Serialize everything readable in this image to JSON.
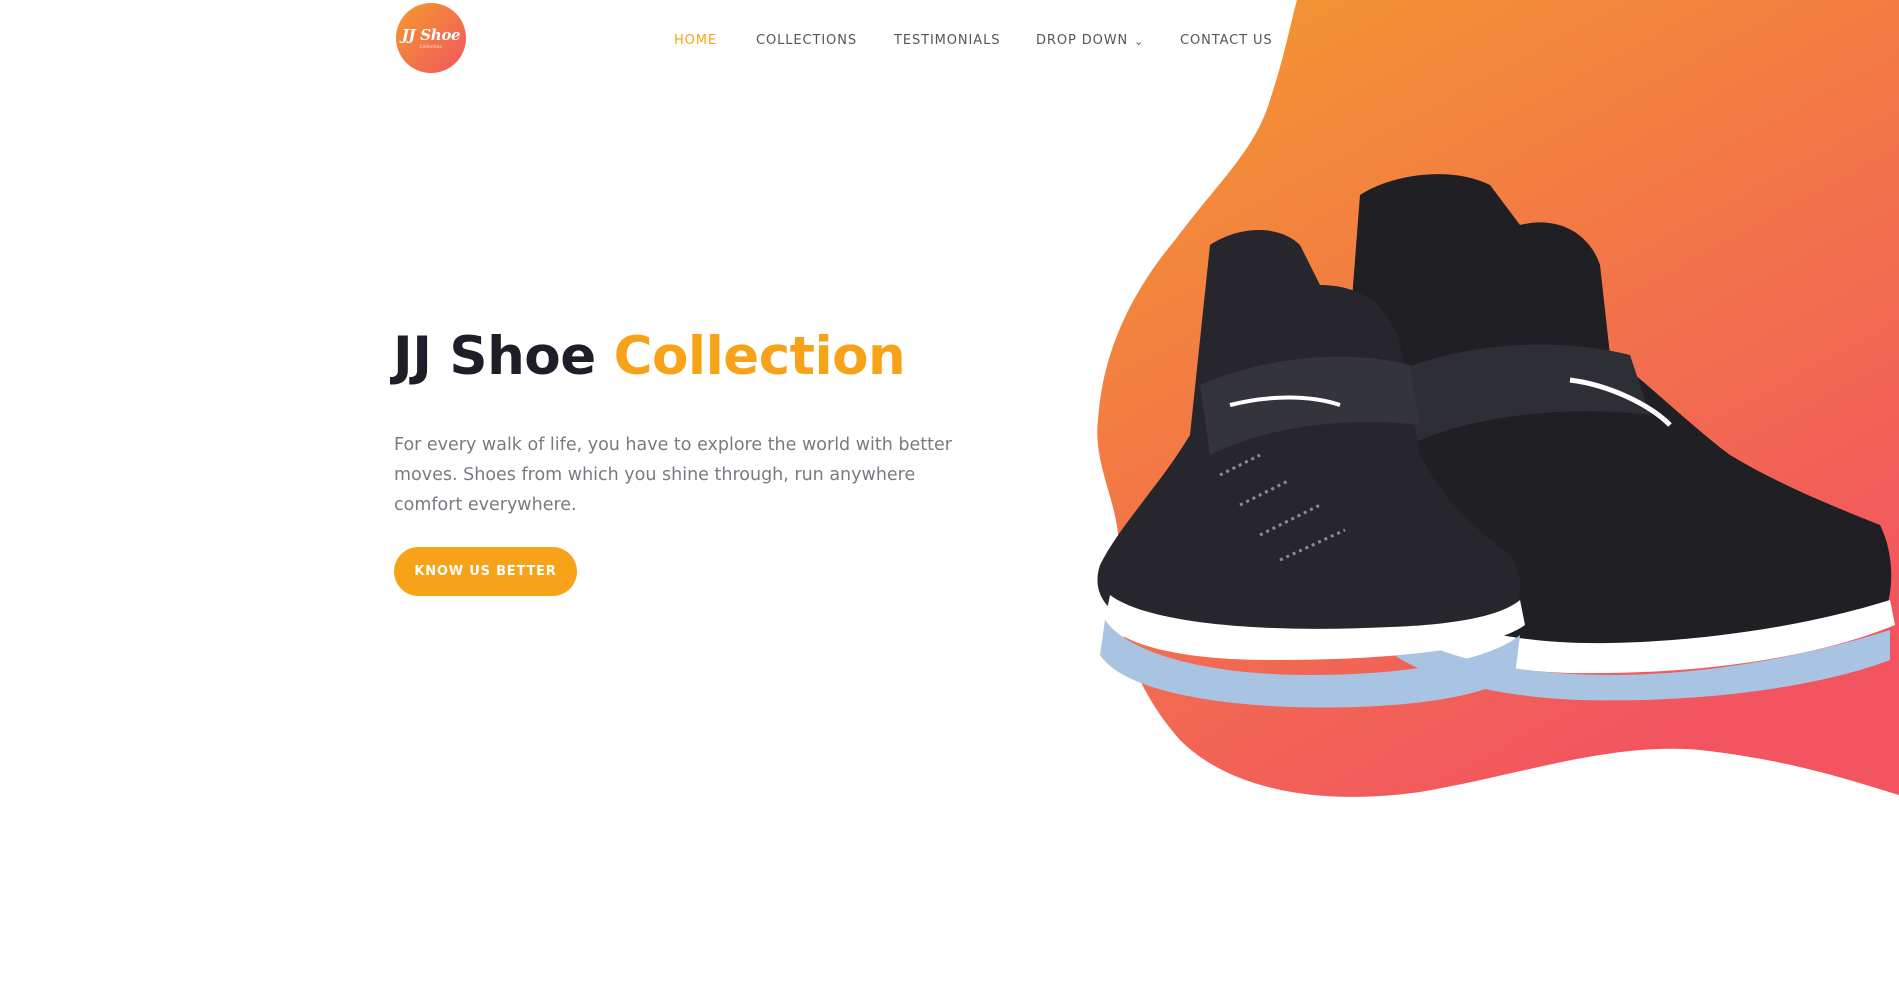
{
  "brand": {
    "logo_text": "JJ Shoe",
    "logo_subtext": "Collection"
  },
  "nav": {
    "items": [
      {
        "label": "HOME",
        "active": true
      },
      {
        "label": "COLLECTIONS",
        "active": false
      },
      {
        "label": "TESTIMONIALS",
        "active": false
      },
      {
        "label": "DROP DOWN",
        "active": false,
        "has_dropdown": true
      },
      {
        "label": "CONTACT US",
        "active": false
      }
    ],
    "dropdown_icon": "chevron-down-icon"
  },
  "hero": {
    "title_part1": "JJ Shoe",
    "title_part2": "Collection",
    "description": "For every walk of life, you have to explore the world with better moves. Shoes from which you shine through, run anywhere comfort everywhere.",
    "cta_label": "KNOW US BETTER"
  },
  "colors": {
    "accent": "#f7a319",
    "heading": "#1e1e28",
    "body_text": "#7a7a82",
    "nav_text": "#555555",
    "gradient_start": "#f39a2e",
    "gradient_end": "#f2555f"
  },
  "image": {
    "subject": "pair-of-black-basketball-sneakers"
  }
}
